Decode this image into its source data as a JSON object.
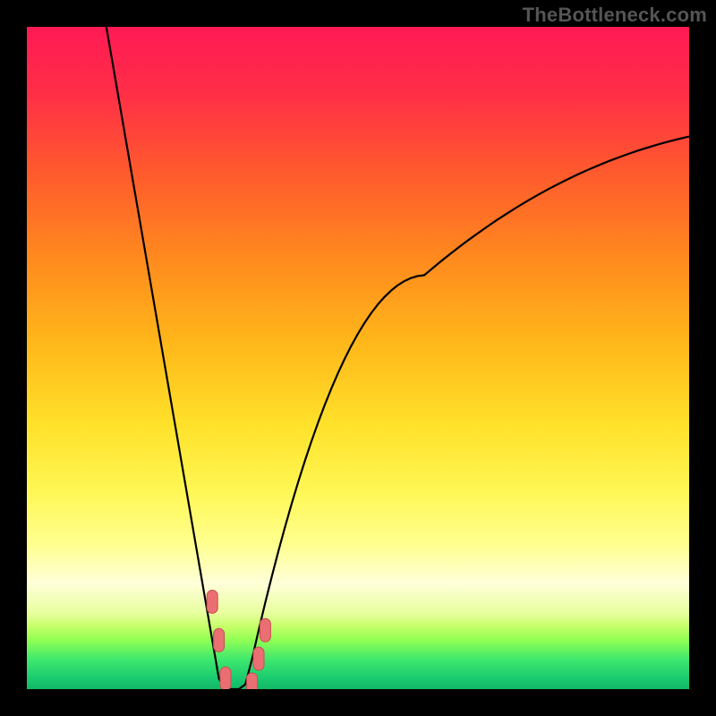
{
  "watermark": "TheBottleneck.com",
  "colors": {
    "frame": "#000000",
    "curve": "#000000",
    "marker_fill": "#ea6f72",
    "marker_stroke": "#c74f52",
    "gradient_stops": [
      {
        "offset": 0.0,
        "color": "#ff1a55"
      },
      {
        "offset": 0.1,
        "color": "#ff2e47"
      },
      {
        "offset": 0.22,
        "color": "#ff5a2d"
      },
      {
        "offset": 0.35,
        "color": "#ff8a1e"
      },
      {
        "offset": 0.48,
        "color": "#ffb81a"
      },
      {
        "offset": 0.6,
        "color": "#ffe12a"
      },
      {
        "offset": 0.7,
        "color": "#fff754"
      },
      {
        "offset": 0.78,
        "color": "#ffff8e"
      },
      {
        "offset": 0.84,
        "color": "#ffffd9"
      },
      {
        "offset": 0.885,
        "color": "#e8ff9f"
      },
      {
        "offset": 0.905,
        "color": "#c6ff6a"
      },
      {
        "offset": 0.925,
        "color": "#93ff53"
      },
      {
        "offset": 0.955,
        "color": "#3fe86e"
      },
      {
        "offset": 0.985,
        "color": "#19c96f"
      },
      {
        "offset": 1.0,
        "color": "#13b766"
      }
    ]
  },
  "chart_data": {
    "type": "line",
    "title": "",
    "xlabel": "",
    "ylabel": "",
    "x": [
      0,
      1,
      2,
      3,
      4,
      5,
      6,
      7,
      8,
      9,
      10,
      11,
      12,
      13,
      14,
      15,
      16,
      17,
      18,
      19,
      20,
      21,
      22,
      23,
      24,
      25,
      26,
      27,
      28,
      29,
      30,
      31,
      32,
      33,
      34,
      35,
      36,
      37,
      38,
      39,
      40,
      41,
      42,
      43,
      44,
      45,
      46,
      47,
      48,
      49,
      50,
      51,
      52,
      53,
      54,
      55,
      56,
      57,
      58,
      59,
      60,
      61,
      62,
      63,
      64,
      65,
      66,
      67,
      68,
      69,
      70,
      71,
      72,
      73,
      74,
      75,
      76,
      77,
      78,
      79,
      80,
      81,
      82,
      83,
      84,
      85,
      86,
      87,
      88,
      89,
      90,
      91,
      92,
      93,
      94,
      95,
      96,
      97,
      98,
      99,
      100
    ],
    "values": [
      null,
      null,
      null,
      null,
      null,
      null,
      null,
      null,
      null,
      null,
      null,
      null,
      100,
      94.21,
      88.42,
      82.63,
      76.84,
      71.05,
      65.26,
      59.47,
      53.68,
      47.89,
      42.11,
      36.32,
      30.53,
      24.74,
      18.95,
      13.16,
      7.37,
      1.58,
      0,
      0,
      0,
      0.73,
      4.55,
      8.9,
      13.07,
      17.07,
      20.9,
      24.56,
      28.05,
      31.38,
      34.53,
      37.51,
      40.32,
      42.97,
      45.45,
      47.76,
      49.9,
      51.87,
      53.68,
      55.32,
      56.79,
      58.09,
      59.22,
      60.18,
      60.98,
      61.61,
      62.07,
      62.37,
      62.5,
      63.34,
      64.17,
      64.98,
      65.77,
      66.55,
      67.31,
      68.05,
      68.77,
      69.48,
      70.17,
      70.85,
      71.5,
      72.14,
      72.77,
      73.37,
      73.96,
      74.53,
      75.09,
      75.63,
      76.15,
      76.66,
      77.15,
      77.63,
      78.09,
      78.53,
      78.96,
      79.37,
      79.77,
      80.15,
      80.52,
      80.88,
      81.22,
      81.54,
      81.85,
      82.15,
      82.44,
      82.71,
      82.97,
      83.21,
      83.44
    ],
    "xlim": [
      0,
      100
    ],
    "ylim": [
      0,
      100
    ],
    "markers": [
      {
        "x": 28,
        "y": 13.2
      },
      {
        "x": 29,
        "y": 7.4
      },
      {
        "x": 30,
        "y": 1.6
      },
      {
        "x": 34,
        "y": 0.7
      },
      {
        "x": 35,
        "y": 4.6
      },
      {
        "x": 36,
        "y": 8.9
      }
    ]
  }
}
